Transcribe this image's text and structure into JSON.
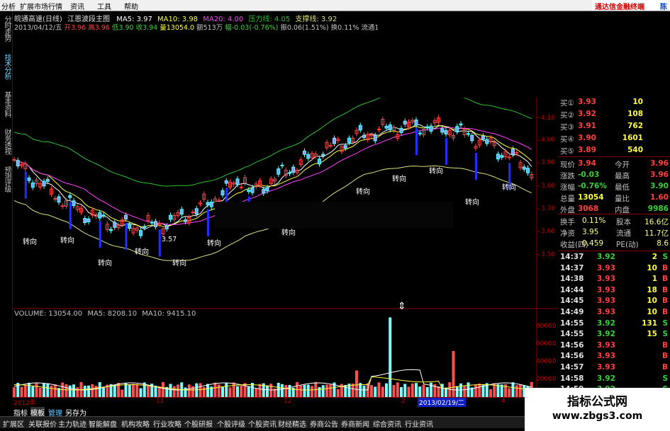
{
  "menubar": {
    "items": [
      "分析",
      "扩展市场行情",
      "资讯",
      "工具",
      "帮助"
    ],
    "promo": "通达信金融终端",
    "promo_tail": "陈"
  },
  "left_tabs": [
    "分时走势",
    "技术分析",
    "基本资料",
    "财务透视",
    "预测评级"
  ],
  "header": {
    "line1": {
      "name": "皖通高速(日线)",
      "indicator": "江恩波段主图",
      "ma5": "MA5: 3.97",
      "ma10": "MA10: 3.98",
      "ma20": "MA20: 4.00",
      "resistance": "压力线: 4.05",
      "support": "支撑线: 3.92"
    },
    "line2": {
      "date": "2013/04/12/五",
      "open": "开3.96",
      "high": "高3.96",
      "low": "低3.90",
      "close": "收3.94",
      "vol": "量13054.0",
      "amount": "额513万",
      "change": "幅-0.03(-0.76%)",
      "amp": "振0.06(1.51%)",
      "turnover": "换0.11%",
      "float": "流通11.7亿",
      "extra": "公路"
    }
  },
  "price_axis": [
    "4.10",
    "4.00",
    "3.90",
    "3.80",
    "3.70",
    "3.60",
    "3.50"
  ],
  "annotations": {
    "zhuanxiang": "转向",
    "min_price": "3.57"
  },
  "volume_header": {
    "volume": "VOLUME: 13054.00",
    "ma5": "MA5: 8208.10",
    "ma10": "MA10: 9415.10"
  },
  "volume_axis": [
    "80000",
    "60000",
    "40000",
    "20000"
  ],
  "time_axis": {
    "year": "2012年",
    "labels": [
      "11",
      "12",
      "2",
      "4"
    ],
    "cursor_date": "2013/02/19/二"
  },
  "order_book": [
    {
      "label": "买①",
      "price": "3.93",
      "vol": "10"
    },
    {
      "label": "买②",
      "price": "3.92",
      "vol": "108"
    },
    {
      "label": "买③",
      "price": "3.91",
      "vol": "762"
    },
    {
      "label": "买④",
      "price": "3.90",
      "vol": "1601"
    },
    {
      "label": "买⑤",
      "price": "3.89",
      "vol": "540"
    }
  ],
  "stats": [
    {
      "l1": "现价",
      "v1": "3.94",
      "l2": "今开",
      "v2": "3.96",
      "c1": "#ff4040",
      "c2": "#ff4040"
    },
    {
      "l1": "涨跌",
      "v1": "-0.03",
      "l2": "最高",
      "v2": "3.96",
      "c1": "#3cd03c",
      "c2": "#ff4040"
    },
    {
      "l1": "涨幅",
      "v1": "-0.76%",
      "l2": "最低",
      "v2": "3.90",
      "c1": "#3cd03c",
      "c2": "#3cd03c"
    },
    {
      "l1": "总量",
      "v1": "13054",
      "l2": "量比",
      "v2": "1.60",
      "c1": "#ffff40",
      "c2": "#ff4040"
    },
    {
      "l1": "外盘",
      "v1": "3068",
      "l2": "内盘",
      "v2": "9986",
      "c1": "#ff4040",
      "c2": "#3cd03c"
    }
  ],
  "fundamentals": [
    {
      "l1": "换手",
      "v1": "0.11%",
      "l2": "股本",
      "v2": "16.6亿"
    },
    {
      "l1": "净资",
      "v1": "3.95",
      "l2": "流通",
      "v2": "11.7亿"
    },
    {
      "l1": "收益(四)",
      "v1": "0.459",
      "l2": "PE(动)",
      "v2": "8.6"
    }
  ],
  "ticks": [
    {
      "time": "14:37",
      "price": "3.92",
      "vol": "2",
      "side": "S"
    },
    {
      "time": "14:37",
      "price": "3.93",
      "vol": "10",
      "side": "B"
    },
    {
      "time": "14:38",
      "price": "3.93",
      "vol": "1",
      "side": "B"
    },
    {
      "time": "14:44",
      "price": "3.93",
      "vol": "18",
      "side": "B"
    },
    {
      "time": "14:45",
      "price": "3.93",
      "vol": "10",
      "side": "B"
    },
    {
      "time": "14:49",
      "price": "3.93",
      "vol": "10",
      "side": "B"
    },
    {
      "time": "14:55",
      "price": "3.92",
      "vol": "131",
      "side": "S"
    },
    {
      "time": "14:55",
      "price": "3.92",
      "vol": "15",
      "side": "S"
    },
    {
      "time": "14:56",
      "price": "3.93",
      "vol": "",
      "side": "B"
    },
    {
      "time": "14:56",
      "price": "3.93",
      "vol": "",
      "side": "B"
    },
    {
      "time": "14:57",
      "price": "3.93",
      "vol": "",
      "side": "B"
    },
    {
      "time": "14:58",
      "price": "3.92",
      "vol": "",
      "side": "S"
    },
    {
      "time": "14:59",
      "price": "3.92",
      "vol": "",
      "side": "S"
    },
    {
      "time": "15:00",
      "price": "3.92",
      "vol": "",
      "side": "S"
    }
  ],
  "sub_tabs": [
    "指标",
    "模板",
    "管理",
    "另存为"
  ],
  "bottom_tabs": [
    "扩展区",
    "关联报价",
    "主力轨迹",
    "智能解盘",
    "机构攻略",
    "行业攻略",
    "个股研报",
    "个股评级",
    "个股资讯",
    "财经精选",
    "券商公告",
    "券商新闻",
    "综合资讯",
    "行业资讯"
  ],
  "watermark": {
    "title": "指标公式网",
    "url": "www.zbgs3.com"
  },
  "colors": {
    "up": "#ff4040",
    "down": "#54ffff",
    "ma5": "#ffffff",
    "ma10": "#ffff40",
    "ma20": "#ff40ff",
    "upper_band": "#30c030",
    "lower_band": "#e0e080",
    "volume_bar_down": "#7fffff",
    "volume_bar_up": "#ff5050"
  }
}
